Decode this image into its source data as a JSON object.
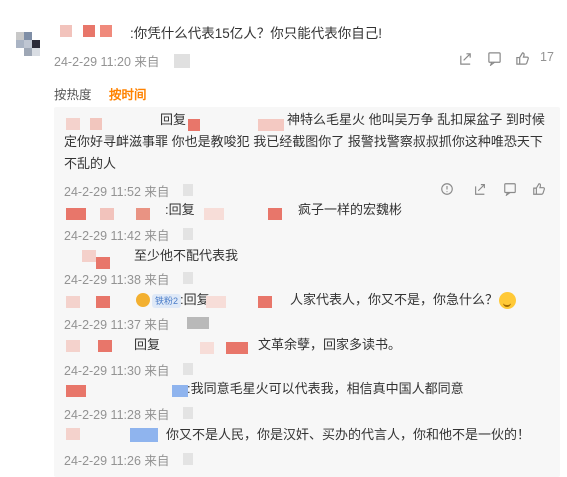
{
  "colors": {
    "accent": "#ff8200",
    "meta": "#939393",
    "panel_bg": "#f7f7f7",
    "mosaic_red": "#e86a5a",
    "mosaic_blue": "#8fb4ee"
  },
  "main_comment": {
    "text": ":你凭什么代表15亿人？你只能代表你自己!",
    "time": "24-2-29 11:20 来自",
    "like_count": "17",
    "actions": [
      "share-icon",
      "comment-icon",
      "like-icon"
    ]
  },
  "sort": {
    "hot": "按热度",
    "time": "按时间"
  },
  "replies": [
    {
      "text_prefix": "回复",
      "text": "神特么毛星火 他叫吴万争 乱扣屎盆子 到时候",
      "text2": "定你好寻衅滋事罪 你也是教唆犯 我已经截图你了 报警找警察叔叔抓你这种唯恐天下",
      "text3": "不乱的人",
      "time": "24-2-29 11:52 来自"
    },
    {
      "text_prefix": ":回复",
      "text": "疯子一样的宏魏彬",
      "time": "24-2-29 11:42 来自"
    },
    {
      "text": "至少他不配代表我",
      "time": "24-2-29 11:38 来自"
    },
    {
      "badge": "铁粉2",
      "text_prefix": ":回复",
      "text": "人家代表人，你又不是，你急什么？",
      "time": "24-2-29 11:37 来自"
    },
    {
      "text_prefix": "回复",
      "text": "文革余孽，回家多读书。",
      "time": "24-2-29 11:30 来自"
    },
    {
      "text": ":我同意毛星火可以代表我，相信真中国人都同意",
      "time": "24-2-29 11:28 来自"
    },
    {
      "text": "你又不是人民，你是汉奸、买办的代言人，你和他不是一伙的！",
      "time": "24-2-29 11:26 来自"
    }
  ]
}
